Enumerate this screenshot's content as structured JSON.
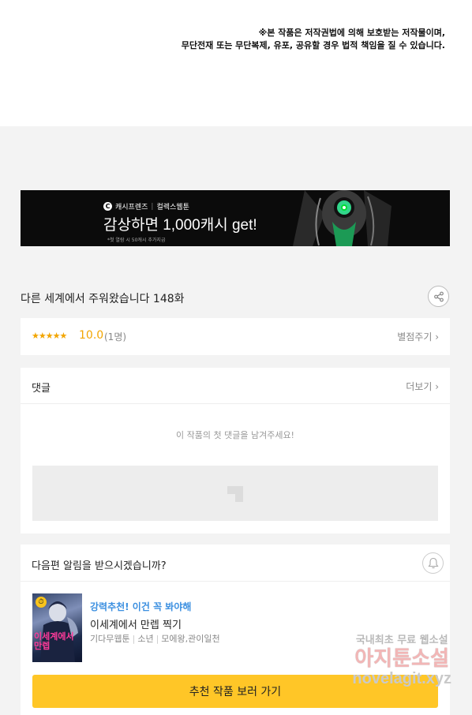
{
  "notice": {
    "line1": "※본 작품은 저작권법에 의해 보호받는 저작물이며,",
    "line2": "무단전재 또는 무단복제, 유포, 공유할 경우 법적 책임을 질 수 있습니다."
  },
  "banner": {
    "brand_badge": "C",
    "brand": "캐시프렌즈",
    "partner": "컬렉스웹툰",
    "headline": "감상하면 1,000캐시 get!",
    "fineprint": "*첫 열람 시 50캐시 추가지급"
  },
  "episode": {
    "title": "다른 세계에서 주워왔습니다 148화"
  },
  "rating": {
    "stars": "★★★★★",
    "score": "10.0",
    "count": "(1명)",
    "action": "별점주기 ›"
  },
  "comments": {
    "title": "댓글",
    "more": "더보기 ›",
    "empty": "이 작품의 첫 댓글을 남겨주세요!"
  },
  "notify": {
    "title": "다음편 알림을 받으시겠습니까?"
  },
  "recommend": {
    "thumb_title": "이세계에서 만렙",
    "tag": "강력추천! 이건 꼭 봐야해",
    "title": "이세계에서 만렙 찍기",
    "genre": "기다무웹툰",
    "audience": "소년",
    "authors": "모에왕,관이일천",
    "cta": "추천 작품 보러 가기"
  },
  "watermark": {
    "line1": "국내최초 무료 웹소설",
    "line2": "아지툰소설",
    "line3": "novelagit.xyz"
  },
  "colors": {
    "accent_yellow": "#ffc627",
    "star_orange": "#f2a500",
    "tag_blue": "#3b8fe0"
  }
}
